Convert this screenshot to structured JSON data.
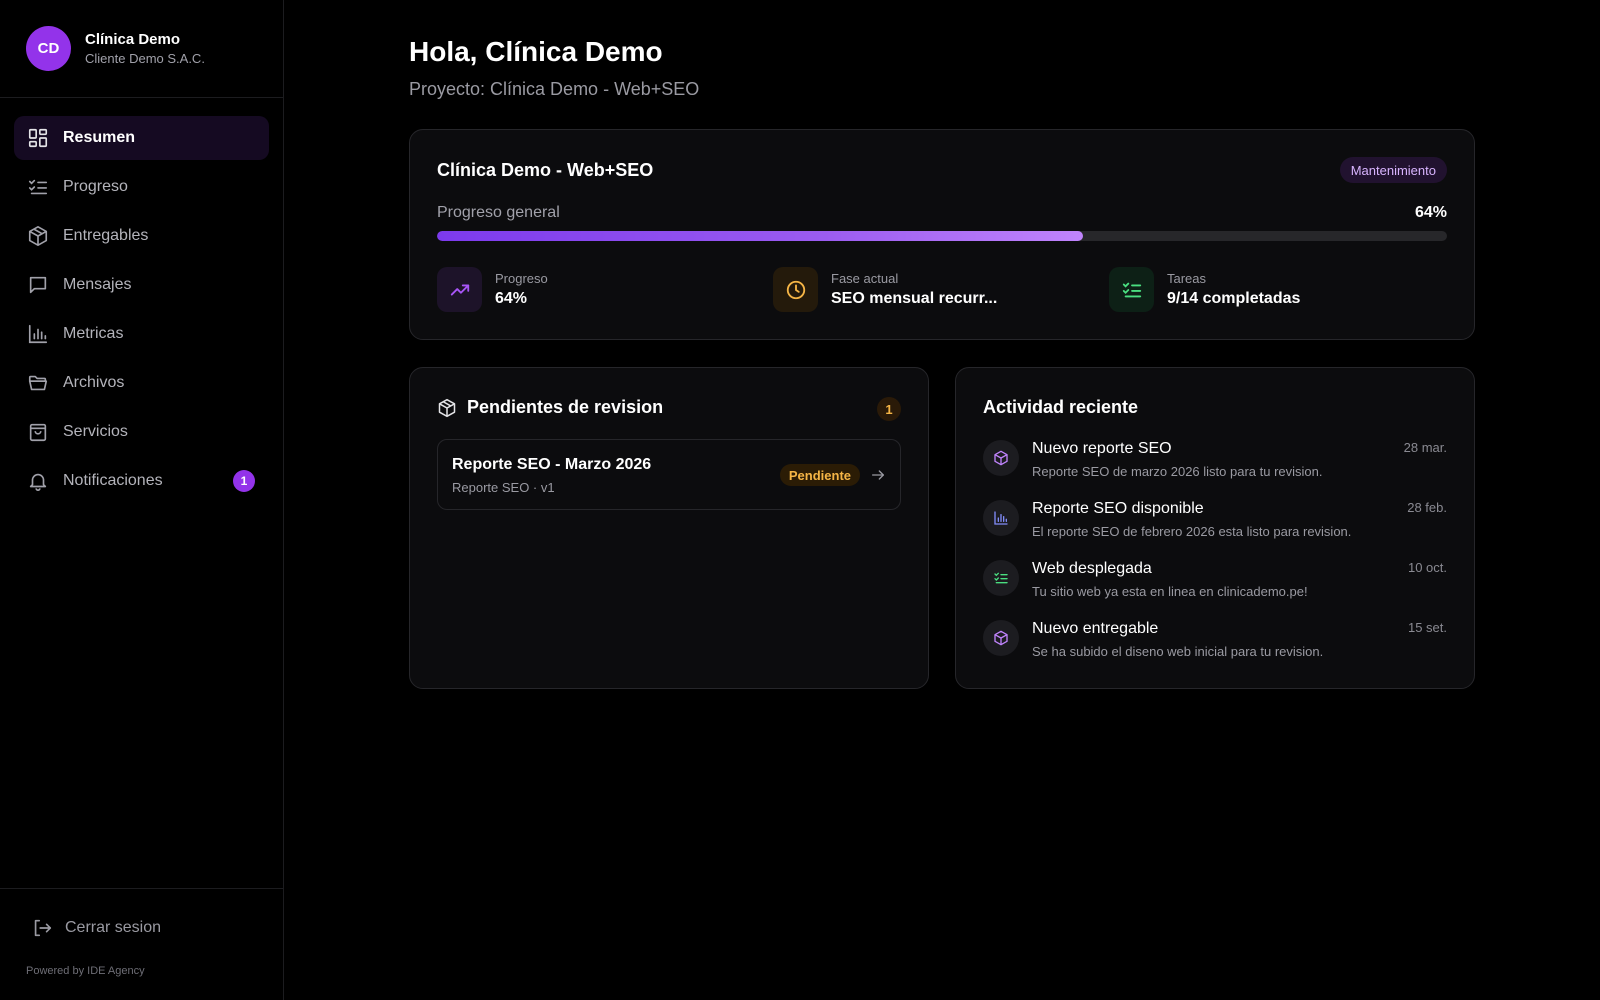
{
  "profile": {
    "initials": "CD",
    "name": "Clínica Demo",
    "company": "Cliente Demo S.A.C."
  },
  "nav": {
    "items": [
      {
        "label": "Resumen",
        "icon": "grid-icon",
        "active": true
      },
      {
        "label": "Progreso",
        "icon": "list-check-icon"
      },
      {
        "label": "Entregables",
        "icon": "package-icon"
      },
      {
        "label": "Mensajes",
        "icon": "message-icon"
      },
      {
        "label": "Metricas",
        "icon": "bar-chart-icon"
      },
      {
        "label": "Archivos",
        "icon": "folder-icon"
      },
      {
        "label": "Servicios",
        "icon": "shopping-bag-icon"
      },
      {
        "label": "Notificaciones",
        "icon": "bell-icon",
        "badge": "1"
      }
    ],
    "logout": "Cerrar sesion",
    "powered_by": "Powered by IDE Agency"
  },
  "header": {
    "greeting": "Hola, Clínica Demo",
    "project": "Proyecto: Clínica Demo - Web+SEO"
  },
  "project_card": {
    "title": "Clínica Demo - Web+SEO",
    "phase_badge": "Mantenimiento",
    "progress_label": "Progreso general",
    "progress_value": "64%",
    "progress_fraction": 0.64,
    "stats": [
      {
        "label": "Progreso",
        "value": "64%",
        "icon": "trending-up-icon",
        "color": "#a855f7"
      },
      {
        "label": "Fase actual",
        "value": "SEO mensual recurr...",
        "icon": "clock-icon",
        "color": "#f5b546"
      },
      {
        "label": "Tareas",
        "value": "9/14 completadas",
        "icon": "list-check-icon",
        "color": "#4ade80"
      }
    ]
  },
  "pending": {
    "title": "Pendientes de revision",
    "count": "1",
    "items": [
      {
        "title": "Reporte SEO - Marzo 2026",
        "subtitle": "Reporte SEO · v1",
        "status": "Pendiente"
      }
    ]
  },
  "activity": {
    "title": "Actividad reciente",
    "items": [
      {
        "title": "Nuevo reporte SEO",
        "desc": "Reporte SEO de marzo 2026 listo para tu revision.",
        "date": "28 mar.",
        "icon": "package-icon",
        "color": "#c084fc"
      },
      {
        "title": "Reporte SEO disponible",
        "desc": "El reporte SEO de febrero 2026 esta listo para revision.",
        "date": "28 feb.",
        "icon": "bar-chart-icon",
        "color": "#818cf8"
      },
      {
        "title": "Web desplegada",
        "desc": "Tu sitio web ya esta en linea en clinicademo.pe!",
        "date": "10 oct.",
        "icon": "list-check-icon",
        "color": "#4ade80"
      },
      {
        "title": "Nuevo entregable",
        "desc": "Se ha subido el diseno web inicial para tu revision.",
        "date": "15 set.",
        "icon": "package-icon",
        "color": "#c084fc"
      }
    ]
  },
  "colors": {
    "accent": "#9333ea",
    "background": "#000000",
    "card": "#0c0c0e",
    "pending_status": "#f5b546"
  }
}
